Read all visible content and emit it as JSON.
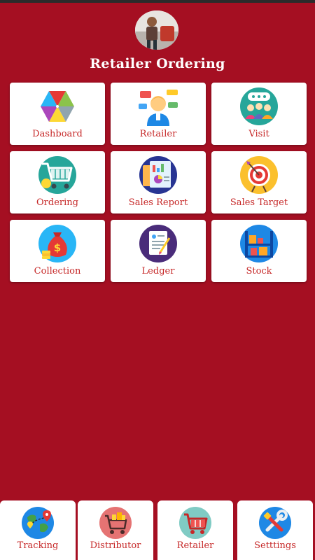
{
  "app": {
    "title": "Retailer Ordering",
    "background_color": "#a50f22",
    "label_color": "#c62828"
  },
  "profile": {
    "avatar_icon": "user-photo-icon"
  },
  "grid": {
    "items": [
      {
        "label": "Dashboard",
        "icon": "colorful-triangles-icon"
      },
      {
        "label": "Retailer",
        "icon": "retailer-person-icon"
      },
      {
        "label": "Visit",
        "icon": "group-chat-icon"
      },
      {
        "label": "Ordering",
        "icon": "shopping-cart-icon"
      },
      {
        "label": "Sales Report",
        "icon": "report-chart-icon"
      },
      {
        "label": "Sales Target",
        "icon": "target-arrow-icon"
      },
      {
        "label": "Collection",
        "icon": "money-bag-icon"
      },
      {
        "label": "Ledger",
        "icon": "ledger-document-icon"
      },
      {
        "label": "Stock",
        "icon": "stock-shelves-icon"
      }
    ]
  },
  "bottom_nav": {
    "items": [
      {
        "label": "Tracking",
        "icon": "globe-location-icon"
      },
      {
        "label": "Distributor",
        "icon": "distributor-cart-icon"
      },
      {
        "label": "Retailer",
        "icon": "retailer-cart-icon"
      },
      {
        "label": "Setttings",
        "icon": "tools-icon"
      }
    ]
  }
}
